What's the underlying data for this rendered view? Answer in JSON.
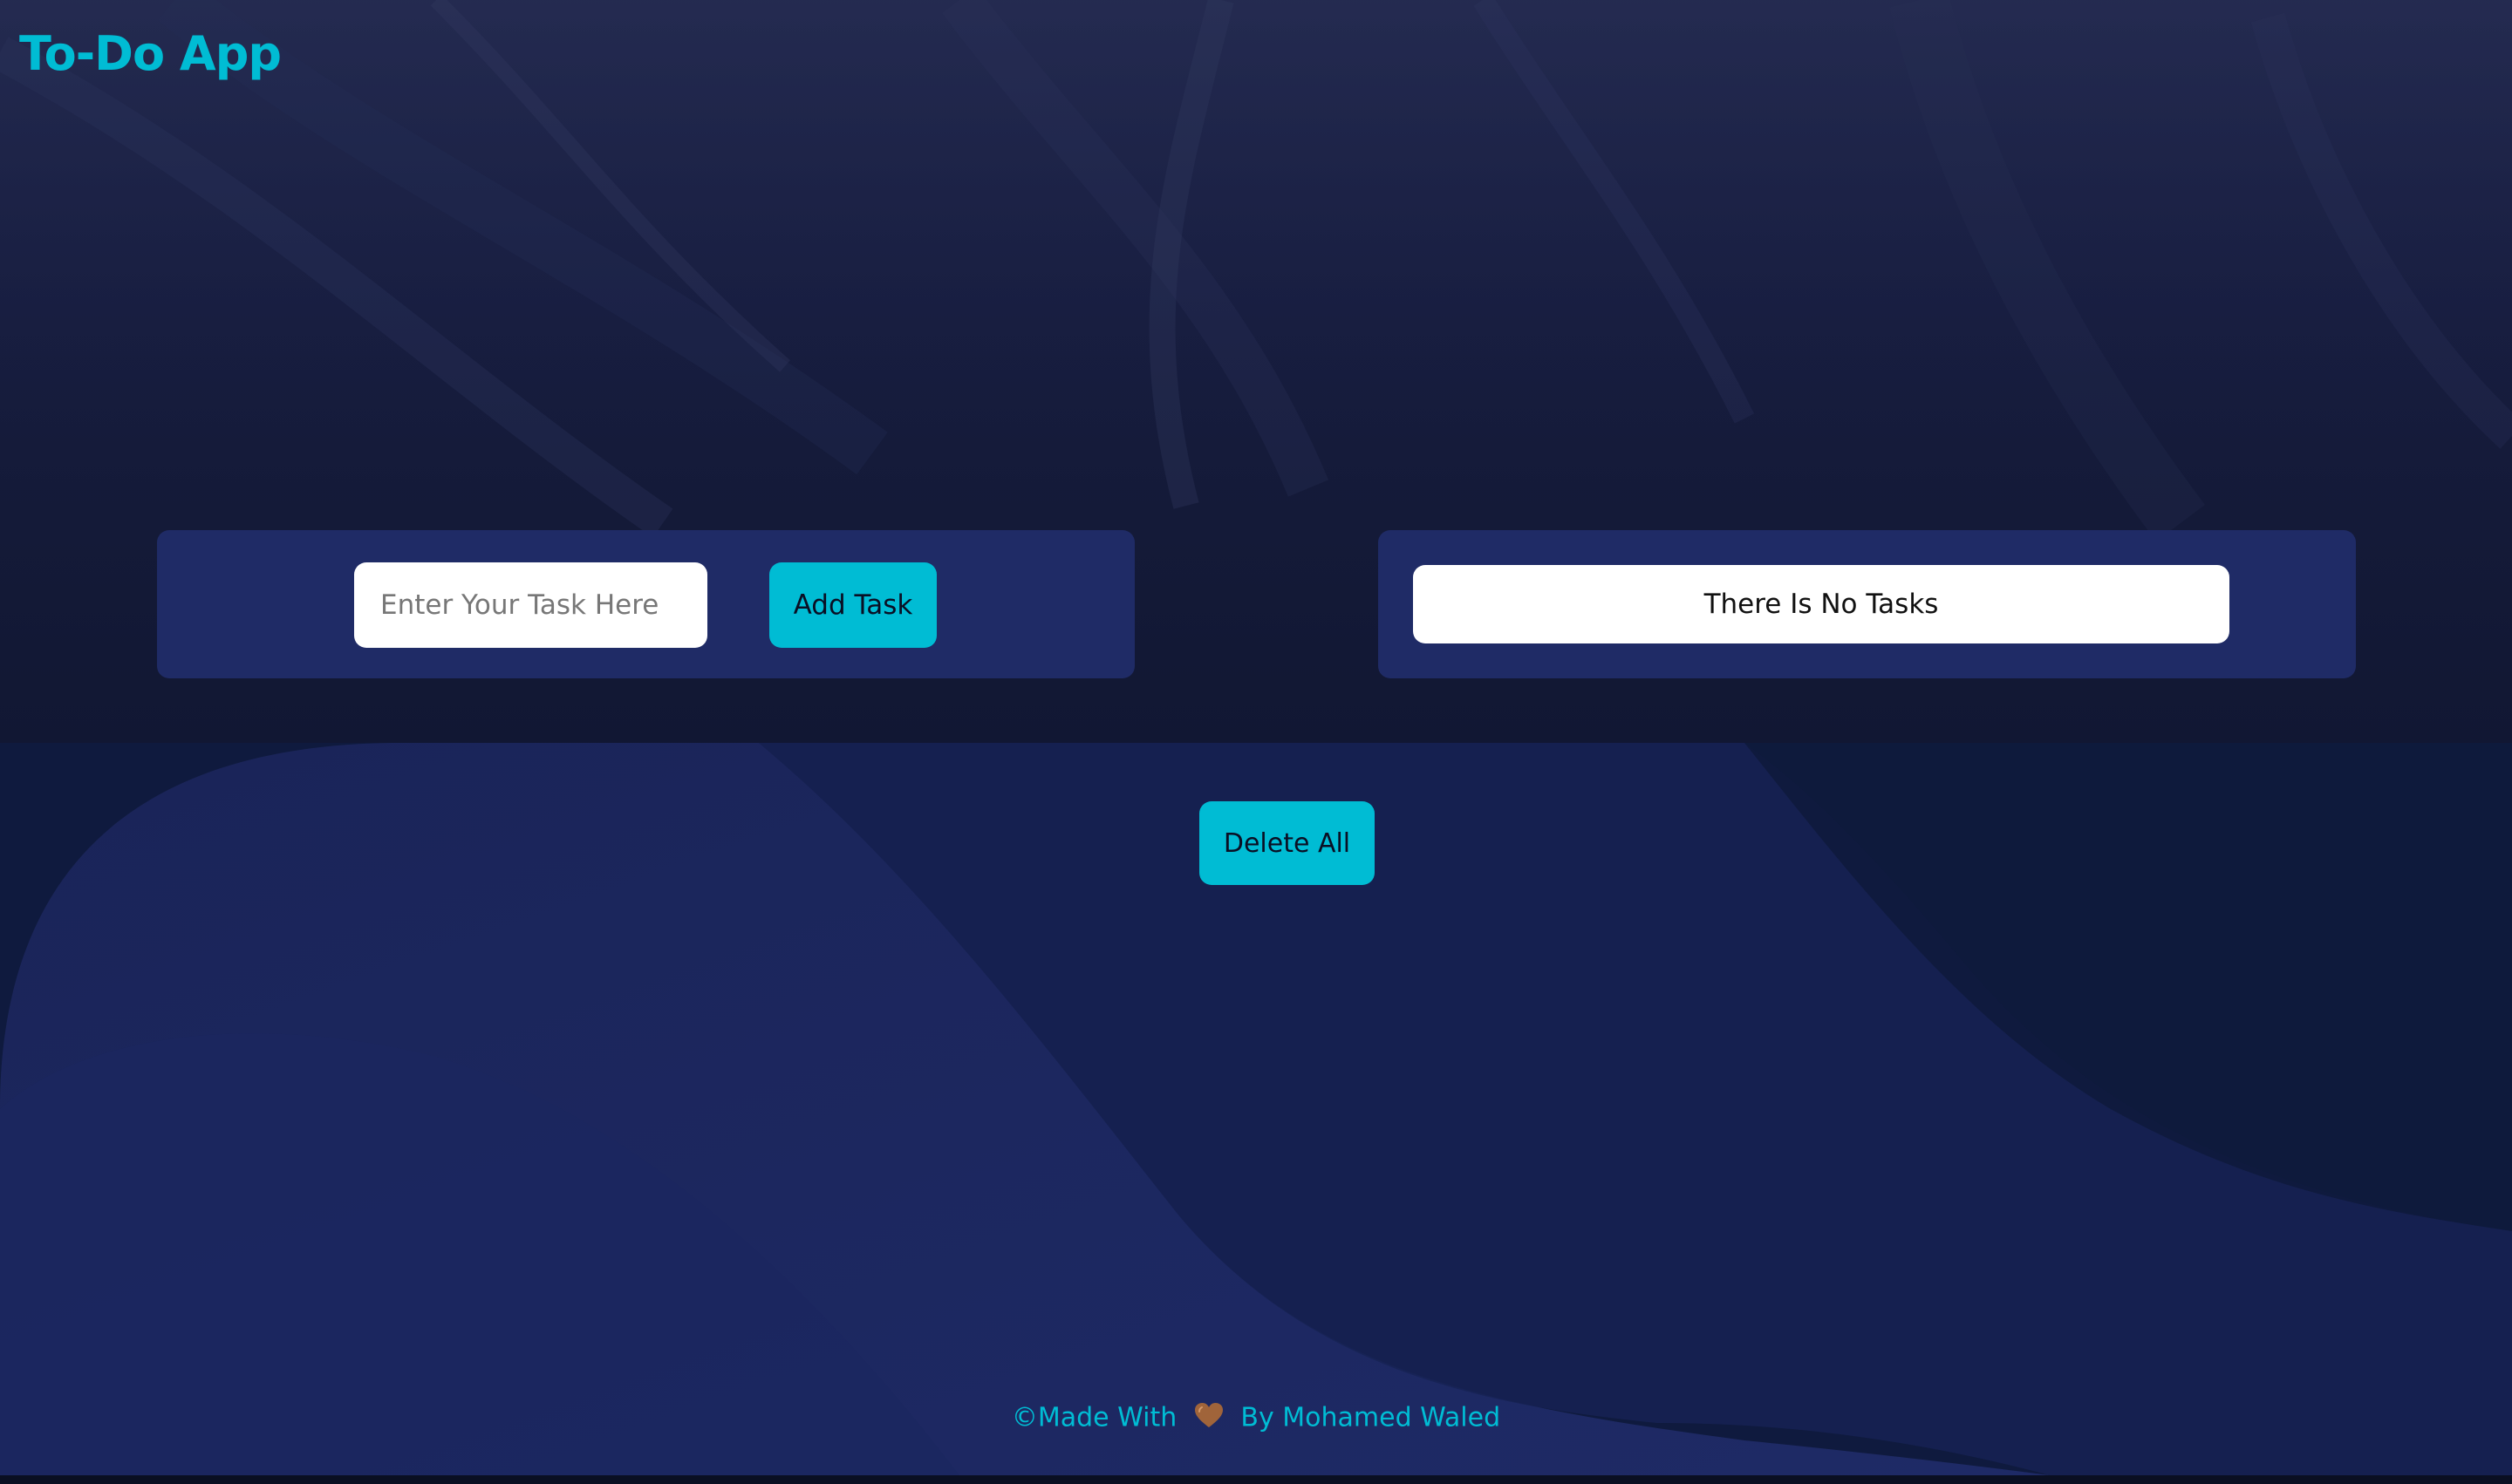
{
  "header": {
    "title": "To-Do App"
  },
  "task_form": {
    "input_placeholder": "Enter Your Task Here",
    "input_value": "",
    "add_button_label": "Add Task"
  },
  "tasks_panel": {
    "empty_message": "There Is No Tasks"
  },
  "actions": {
    "delete_all_label": "Delete All"
  },
  "footer": {
    "prefix": "©Made With",
    "heart_icon": "heart-icon",
    "suffix": "By Mohamed Waled"
  },
  "colors": {
    "accent": "#00bcd4",
    "panel": "#1f2b66",
    "background_top": "#171d3f",
    "background_bottom": "#111a3d",
    "heart": "#a0643a"
  }
}
